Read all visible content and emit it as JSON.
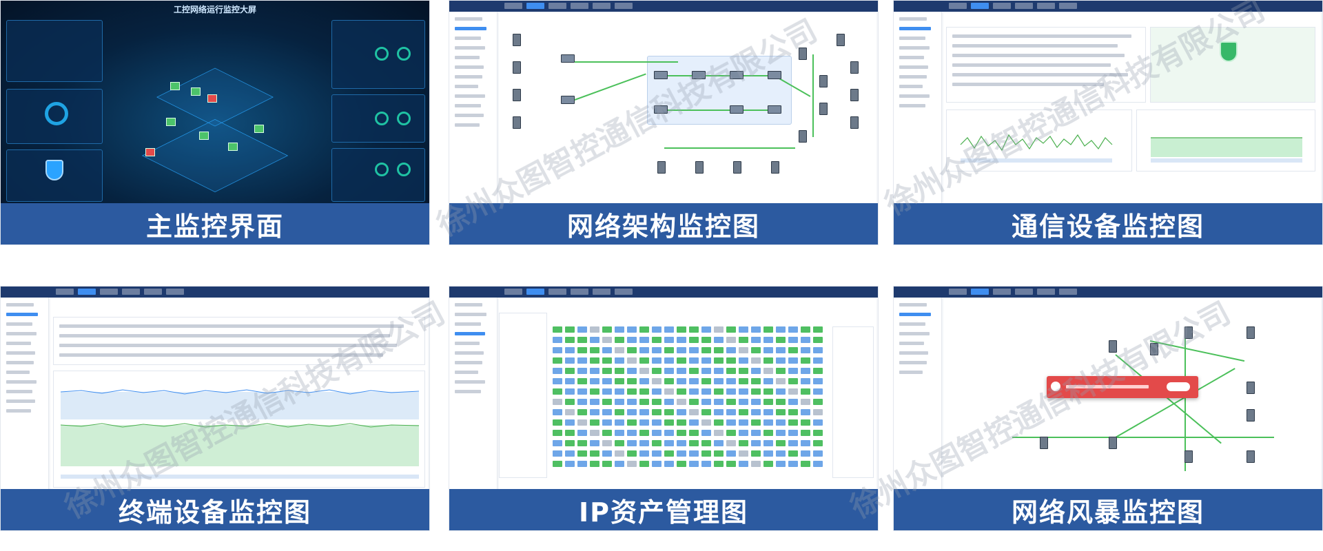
{
  "tiles": [
    {
      "caption": "主监控界面",
      "screen_title": "工控网络运行监控大屏"
    },
    {
      "caption": "网络架构监控图"
    },
    {
      "caption": "通信设备监控图"
    },
    {
      "caption": "终端设备监控图"
    },
    {
      "caption": "IP资产管理图"
    },
    {
      "caption": "网络风暴监控图"
    }
  ],
  "watermark": "徐州众图智控通信科技有限公司",
  "colors": {
    "caption_bg": "#2c5aa0",
    "accent": "#3f8ef0",
    "link_green": "#4bc05a",
    "alert_red": "#e34a4a"
  }
}
